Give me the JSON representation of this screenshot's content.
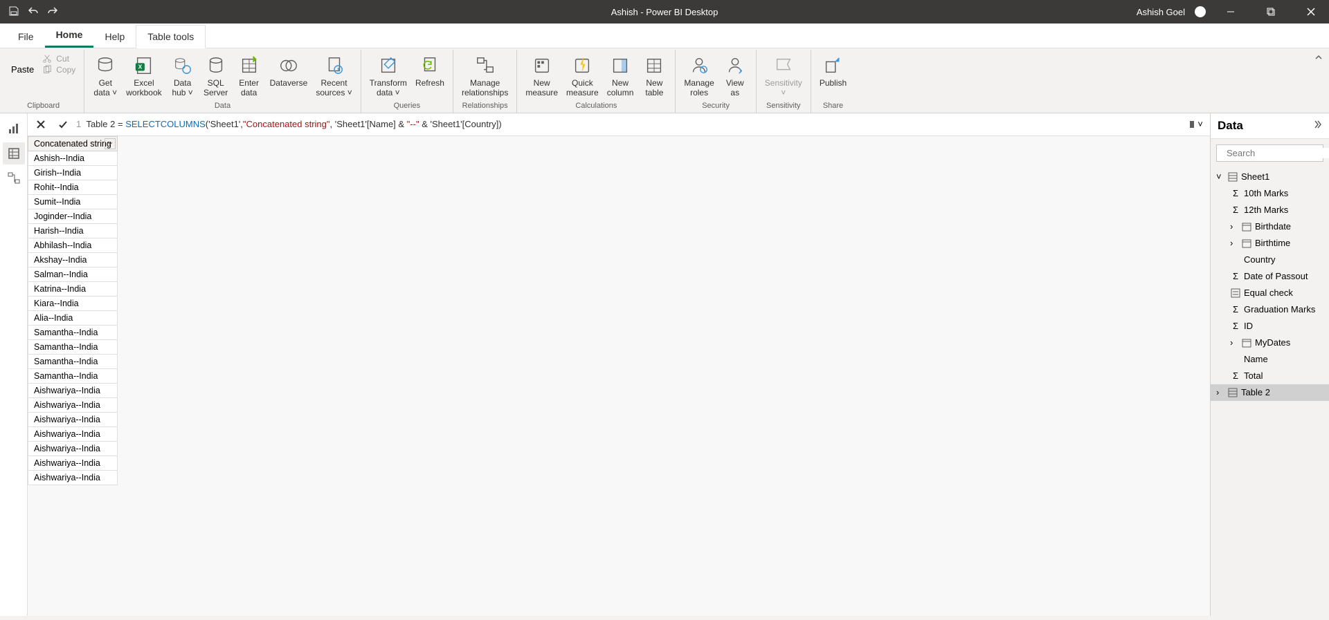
{
  "titlebar": {
    "title": "Ashish - Power BI Desktop",
    "user": "Ashish Goel"
  },
  "tabs": {
    "file": "File",
    "home": "Home",
    "help": "Help",
    "tabletools": "Table tools"
  },
  "ribbon": {
    "clipboard": {
      "paste": "Paste",
      "cut": "Cut",
      "copy": "Copy",
      "label": "Clipboard"
    },
    "data": {
      "getdata": "Get\ndata",
      "excel": "Excel\nworkbook",
      "datahub": "Data\nhub",
      "sql": "SQL\nServer",
      "enterdata": "Enter\ndata",
      "dataverse": "Dataverse",
      "recent": "Recent\nsources",
      "label": "Data"
    },
    "queries": {
      "transform": "Transform\ndata",
      "refresh": "Refresh",
      "label": "Queries"
    },
    "relationships": {
      "manage": "Manage\nrelationships",
      "label": "Relationships"
    },
    "calculations": {
      "newmeasure": "New\nmeasure",
      "quickmeasure": "Quick\nmeasure",
      "newcolumn": "New\ncolumn",
      "newtable": "New\ntable",
      "label": "Calculations"
    },
    "security": {
      "roles": "Manage\nroles",
      "viewas": "View\nas",
      "label": "Security"
    },
    "sensitivity": {
      "sensitivity": "Sensitivity",
      "label": "Sensitivity"
    },
    "share": {
      "publish": "Publish",
      "label": "Share"
    }
  },
  "formula": {
    "lineno": "1",
    "lhs": "Table 2 = ",
    "func": "SELECTCOLUMNS",
    "open": "(",
    "arg1": "'Sheet1',",
    "str1": "\"Concatenated string\"",
    "mid": ", 'Sheet1'[Name] & ",
    "str2": "\"--\"",
    "end": " & 'Sheet1'[Country])"
  },
  "table": {
    "header": "Concatenated string",
    "rows": [
      "Ashish--India",
      "Girish--India",
      "Rohit--India",
      "Sumit--India",
      "Joginder--India",
      "Harish--India",
      "Abhilash--India",
      "Akshay--India",
      "Salman--India",
      "Katrina--India",
      "Kiara--India",
      "Alia--India",
      "Samantha--India",
      "Samantha--India",
      "Samantha--India",
      "Samantha--India",
      "Aishwariya--India",
      "Aishwariya--India",
      "Aishwariya--India",
      "Aishwariya--India",
      "Aishwariya--India",
      "Aishwariya--India",
      "Aishwariya--India"
    ]
  },
  "rightpanel": {
    "title": "Data",
    "search_placeholder": "Search",
    "sheet1": "Sheet1",
    "fields": {
      "tenth": "10th Marks",
      "twelfth": "12th Marks",
      "birthdate": "Birthdate",
      "birthtime": "Birthtime",
      "country": "Country",
      "passout": "Date of Passout",
      "equal": "Equal check",
      "grad": "Graduation Marks",
      "id": "ID",
      "mydates": "MyDates",
      "name": "Name",
      "total": "Total"
    },
    "table2": "Table 2"
  }
}
